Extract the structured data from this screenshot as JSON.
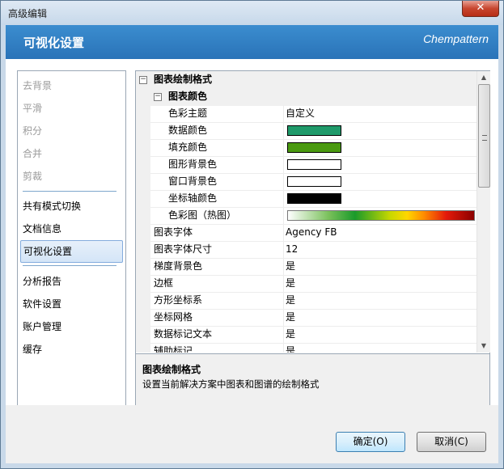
{
  "window": {
    "title": "高级编辑",
    "close_label": "✕"
  },
  "header": {
    "title": "可视化设置",
    "brand": "Chempattern"
  },
  "nav": {
    "disabled_items": [
      "去背景",
      "平滑",
      "积分",
      "合并",
      "剪裁"
    ],
    "items": [
      "共有模式切换",
      "文档信息",
      "可视化设置",
      "分析报告",
      "软件设置",
      "账户管理",
      "缓存"
    ],
    "selected": "可视化设置"
  },
  "grid": {
    "rows": [
      {
        "name": "图表绘制格式",
        "value": "",
        "kind": "category",
        "toggle": "−"
      },
      {
        "name": "图表颜色",
        "value": "",
        "kind": "subcategory",
        "toggle": "−"
      },
      {
        "name": "色彩主题",
        "value": "自定义",
        "kind": "child"
      },
      {
        "name": "数据颜色",
        "value": "",
        "kind": "child",
        "swatch": "#1f9a6a"
      },
      {
        "name": "填充颜色",
        "value": "",
        "kind": "child",
        "swatch": "#4a9a10"
      },
      {
        "name": "图形背景色",
        "value": "",
        "kind": "child",
        "swatch": "#ffffff"
      },
      {
        "name": "窗口背景色",
        "value": "",
        "kind": "child",
        "swatch": "#ffffff"
      },
      {
        "name": "坐标轴颜色",
        "value": "",
        "kind": "child",
        "swatch": "#000000"
      },
      {
        "name": "色彩图（热图）",
        "value": "",
        "kind": "child",
        "gradient": true
      },
      {
        "name": "图表字体",
        "value": "Agency FB",
        "kind": "prop"
      },
      {
        "name": "图表字体尺寸",
        "value": "12",
        "kind": "prop"
      },
      {
        "name": "梯度背景色",
        "value": "是",
        "kind": "prop"
      },
      {
        "name": "边框",
        "value": "是",
        "kind": "prop"
      },
      {
        "name": "方形坐标系",
        "value": "是",
        "kind": "prop"
      },
      {
        "name": "坐标网格",
        "value": "是",
        "kind": "prop"
      },
      {
        "name": "数据标记文本",
        "value": "是",
        "kind": "prop"
      },
      {
        "name": "辅助标记",
        "value": "是",
        "kind": "prop"
      }
    ]
  },
  "description": {
    "title": "图表绘制格式",
    "text": "设置当前解决方案中图表和图谱的绘制格式"
  },
  "buttons": {
    "ok": "确定(O)",
    "cancel": "取消(C)"
  }
}
